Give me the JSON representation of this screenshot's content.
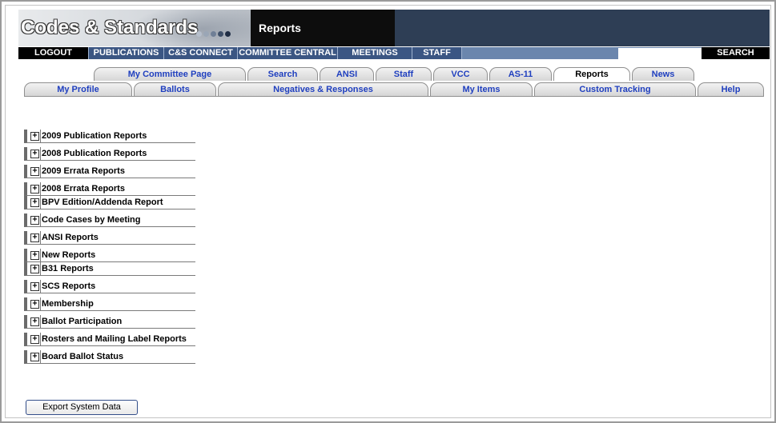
{
  "banner": {
    "title": "Codes & Standards",
    "page_title": "Reports",
    "dot_colors": [
      "#b6bfcc",
      "#9aa6b6",
      "#6f7f96",
      "#3e4f68",
      "#1f2d44"
    ]
  },
  "navbar": {
    "items": [
      "LOGOUT",
      "PUBLICATIONS",
      "C&S CONNECT",
      "COMMITTEE CENTRAL",
      "MEETINGS",
      "STAFF"
    ],
    "search_value": "",
    "search_label": "SEARCH"
  },
  "tabs_top": [
    "My Committee Page",
    "Search",
    "ANSI",
    "Staff",
    "VCC",
    "AS-11",
    "Reports",
    "News"
  ],
  "tabs_bottom": [
    "My Profile",
    "Ballots",
    "Negatives & Responses",
    "My Items",
    "Custom Tracking",
    "Help"
  ],
  "reports": [
    "2009 Publication Reports",
    "2008 Publication Reports",
    "2009 Errata Reports",
    "2008 Errata Reports",
    "BPV Edition/Addenda Report",
    "Code Cases by Meeting",
    "ANSI Reports",
    "New Reports",
    "B31 Reports",
    "SCS Reports",
    "Membership",
    "Ballot Participation",
    "Rosters and Mailing Label Reports",
    "Board Ballot Status"
  ],
  "expand_glyph": "+",
  "export_button": "Export System Data",
  "colors": {
    "link_blue": "#1f3fbf",
    "nav_blue": "#3b5683",
    "nav_bar": "#6b86ad"
  }
}
